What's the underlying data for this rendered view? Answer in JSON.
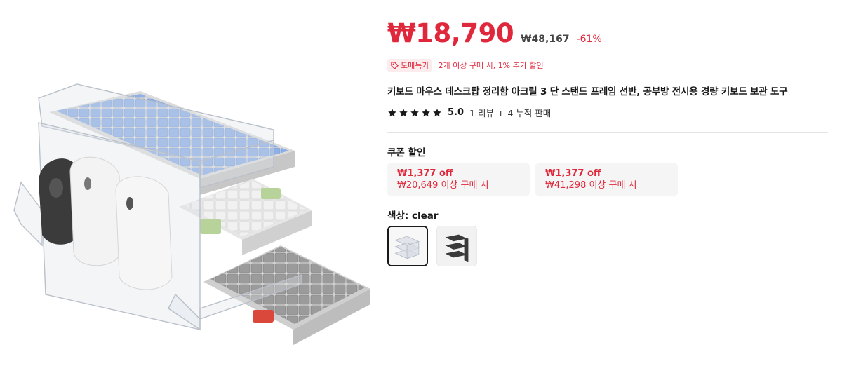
{
  "product": {
    "image_name": "acrylic-keyboard-mouse-stand-image"
  },
  "price": {
    "current": "₩18,790",
    "original": "₩48,167",
    "discount": "-61%"
  },
  "promo": {
    "badge": "도매득가",
    "text": "2개 이상 구매 시, 1% 추가 할인"
  },
  "title": "키보드 마우스 데스크탑 정리함 아크릴 3 단 스탠드 프레임 선반, 공부방 전시용 경량 키보드 보관 도구",
  "rating": {
    "stars": 5,
    "value": "5.0",
    "reviews": "1 리뷰",
    "separator": "ı",
    "sales": "4 누적 판매"
  },
  "coupons": {
    "heading": "쿠폰 할인",
    "items": [
      {
        "amount": "₩1,377 off",
        "condition": "₩20,649 이상 구매 시"
      },
      {
        "amount": "₩1,377 off",
        "condition": "₩41,298 이상 구매 시"
      }
    ]
  },
  "color": {
    "label": "색상: clear",
    "options": [
      {
        "name": "clear",
        "selected": true
      },
      {
        "name": "black",
        "selected": false
      }
    ]
  },
  "colors": {
    "accent": "#e0283c",
    "badge_bg": "#fdecee",
    "coupon_bg": "#f5f5f5",
    "divider": "#e4e4e4"
  }
}
